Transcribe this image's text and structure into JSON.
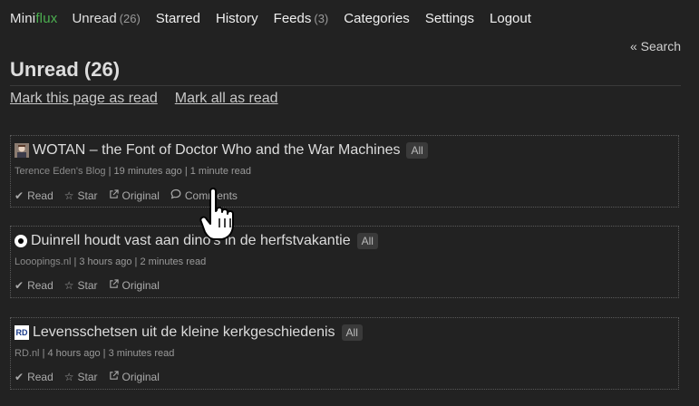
{
  "app": {
    "logo_part1": "Mini",
    "logo_part2": "flux"
  },
  "nav": [
    {
      "label": "Unread",
      "count": "(26)"
    },
    {
      "label": "Starred",
      "count": ""
    },
    {
      "label": "History",
      "count": ""
    },
    {
      "label": "Feeds",
      "count": "(3)"
    },
    {
      "label": "Categories",
      "count": ""
    },
    {
      "label": "Settings",
      "count": ""
    },
    {
      "label": "Logout",
      "count": ""
    }
  ],
  "search_link": "« Search",
  "page": {
    "title": "Unread (26)",
    "mark_page": "Mark this page as read",
    "mark_all": "Mark all as read"
  },
  "entries": [
    {
      "title": "WOTAN – the Font of Doctor Who and the War Machines",
      "category": "All",
      "source": "Terence Eden's Blog",
      "time": "19 minutes ago",
      "read_time": "1 minute read",
      "actions": [
        "Read",
        "Star",
        "Original",
        "Comments"
      ]
    },
    {
      "title": "Duinrell houdt vast aan dino's in de herfstvakantie",
      "category": "All",
      "source": "Looopings.nl",
      "time": "3 hours ago",
      "read_time": "2 minutes read",
      "actions": [
        "Read",
        "Star",
        "Original"
      ]
    },
    {
      "title": "Levensschetsen uit de kleine kerkgeschiedenis",
      "category": "All",
      "source": "RD.nl",
      "time": "4 hours ago",
      "read_time": "3 minutes read",
      "actions": [
        "Read",
        "Star",
        "Original"
      ],
      "favicon_text": "RD"
    }
  ],
  "icons": {
    "read": "checkmark-icon",
    "star": "star-icon",
    "original": "external-link-icon",
    "comments": "comment-icon"
  }
}
